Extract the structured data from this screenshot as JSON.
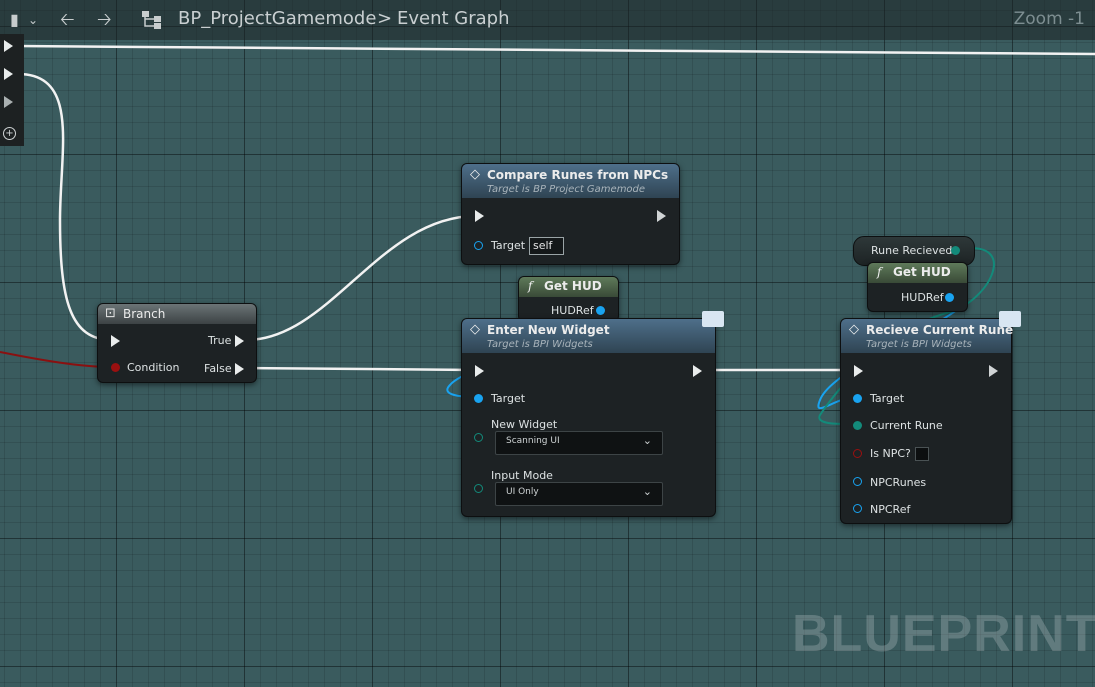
{
  "toolbar": {
    "blueprint_name": "BP_ProjectGamemode",
    "separator": ">",
    "graph_name": "Event Graph",
    "zoom": "Zoom -1",
    "back_icon": "arrow-left",
    "forward_icon": "arrow-right"
  },
  "nodes": {
    "branch": {
      "title": "Branch",
      "condition": "Condition",
      "true_label": "True",
      "false_label": "False"
    },
    "compare": {
      "title": "Compare Runes from NPCs",
      "subtitle": "Target is BP Project Gamemode",
      "target": "Target",
      "target_value": "self"
    },
    "get_hud_1": {
      "title": "Get HUD",
      "output": "HUDRef"
    },
    "enter_widget": {
      "title": "Enter New Widget",
      "subtitle": "Target is BPI Widgets",
      "target": "Target",
      "new_widget_label": "New Widget",
      "new_widget_value": "Scanning UI",
      "input_mode_label": "Input Mode",
      "input_mode_value": "UI Only"
    },
    "rune_received": {
      "label": "Rune Recieved"
    },
    "get_hud_2": {
      "title": "Get HUD",
      "output": "HUDRef"
    },
    "receive_rune": {
      "title": "Recieve Current Rune",
      "subtitle": "Target is BPI Widgets",
      "target": "Target",
      "current_rune": "Current Rune",
      "is_npc": "Is NPC?",
      "npc_runes": "NPCRunes",
      "npc_ref": "NPCRef"
    }
  },
  "watermark": "BLUEPRINT",
  "colors": {
    "exec": "#ffffff",
    "object_pin": "#19a3f0",
    "struct_pin": "#138a7a",
    "bool_pin": "#9a1010",
    "function_head": "#4e6f8a",
    "pure_head": "#5f7a5a"
  }
}
